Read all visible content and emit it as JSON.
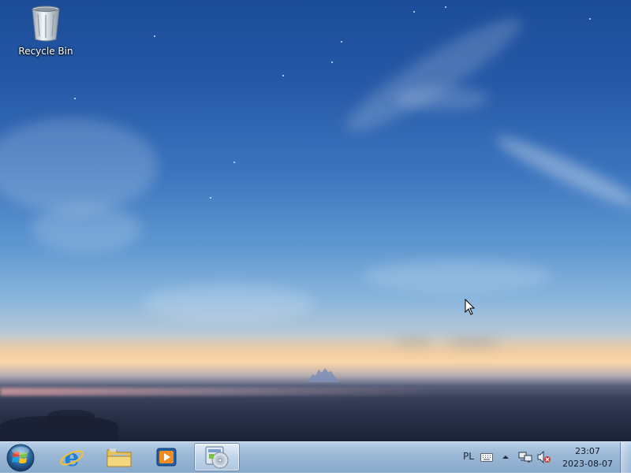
{
  "desktop": {
    "icons": [
      {
        "label": "Recycle Bin",
        "icon": "recycle-bin-icon"
      }
    ]
  },
  "taskbar": {
    "start_button_icon": "windows-logo-icon",
    "pinned_apps": [
      {
        "icon": "internet-explorer-icon",
        "active": false
      },
      {
        "icon": "folder-icon",
        "active": false
      },
      {
        "icon": "media-player-icon",
        "active": false
      },
      {
        "icon": "setup-disc-icon",
        "active": true
      }
    ],
    "tray": {
      "language": "PL",
      "icons": [
        "keyboard-icon",
        "show-hidden-icons-arrow",
        "network-icon",
        "volume-muted-icon"
      ]
    },
    "clock": {
      "time": "23:07",
      "date": "2023-08-07"
    }
  },
  "colors": {
    "taskbar": "#9fbad8",
    "sky_top": "#1b4c98",
    "horizon": "#f3d8b0"
  }
}
